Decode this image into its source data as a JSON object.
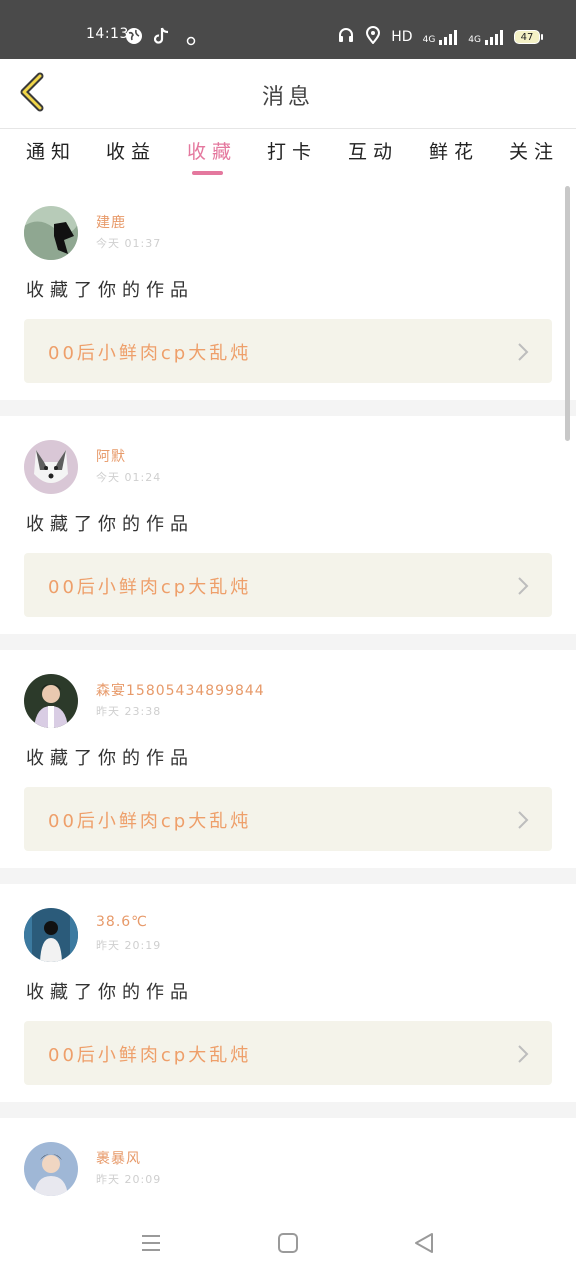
{
  "status_bar": {
    "time": "14:13",
    "hd_label": "HD",
    "network_label": "4G",
    "battery": "47",
    "icons": [
      "globe-icon",
      "tiktok-icon",
      "notification-icon",
      "headset-icon",
      "location-icon",
      "signal-icon",
      "signal-icon-2"
    ]
  },
  "header": {
    "title": "消息",
    "back_icon": "chevron-left-icon"
  },
  "tabs": [
    {
      "label": "通知",
      "active": false
    },
    {
      "label": "收益",
      "active": false
    },
    {
      "label": "收藏",
      "active": true
    },
    {
      "label": "打卡",
      "active": false
    },
    {
      "label": "互动",
      "active": false
    },
    {
      "label": "鲜花",
      "active": false
    },
    {
      "label": "关注",
      "active": false
    }
  ],
  "messages": [
    {
      "user": "建鹿",
      "time": "今天 01:37",
      "action": "收藏了你的作品",
      "work": "00后小鲜肉cp大乱炖"
    },
    {
      "user": "阿默",
      "time": "今天 01:24",
      "action": "收藏了你的作品",
      "work": "00后小鲜肉cp大乱炖"
    },
    {
      "user": "森宴15805434899844",
      "time": "昨天 23:38",
      "action": "收藏了你的作品",
      "work": "00后小鲜肉cp大乱炖"
    },
    {
      "user": "38.6℃",
      "time": "昨天 20:19",
      "action": "收藏了你的作品",
      "work": "00后小鲜肉cp大乱炖"
    },
    {
      "user": "裹暴风",
      "time": "昨天 20:09",
      "action": "",
      "work": ""
    }
  ],
  "colors": {
    "accent": "#e4789e",
    "username": "#e79a6a",
    "work_text": "#ee9f6a",
    "work_bg": "#f4f3ea",
    "status_bar": "#4a4a4a"
  },
  "nav_bar": {
    "icons": [
      "menu-icon",
      "home-square-icon",
      "back-triangle-icon"
    ]
  }
}
